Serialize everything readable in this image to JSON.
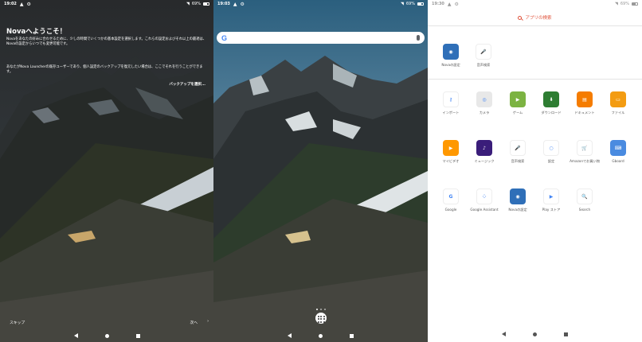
{
  "screen1": {
    "status": {
      "time": "19:02",
      "battery": "69%"
    },
    "title": "Novaへようこそ！",
    "para1": "Novaをあなたの好みに合わせるために、少しの時間でいくつかの基本設定を選択します。これらの設定およびそれ以上の最適は、Novaの設定からいつでも変更可能です。",
    "para2": "あなたがNova Launcherの既存ユーザーであり、個人設定のバックアップを復元したい場合は、ここでそれを行うことができます。",
    "backup_button": "バックアップを選択...",
    "skip_button": "スキップ",
    "next_button": "次へ",
    "next_chevron": "›"
  },
  "screen2": {
    "status": {
      "time": "19:03",
      "battery": "69%"
    },
    "search_logo": "G"
  },
  "screen3": {
    "status": {
      "time": "19:30",
      "battery": "69%"
    },
    "search_label": "アプリの検索",
    "favorites": [
      {
        "label": "Novaの設定",
        "color": "#2f6fb8",
        "glyph": "◉"
      },
      {
        "label": "音声検索",
        "color": "#ffffff",
        "glyph": "🎤"
      }
    ],
    "apps": [
      {
        "label": "インポート",
        "color": "#ffffff",
        "glyph": "⚷"
      },
      {
        "label": "カメラ",
        "color": "#e8e8e8",
        "glyph": "◎"
      },
      {
        "label": "ゲーム",
        "color": "#7cb342",
        "glyph": "▶"
      },
      {
        "label": "ダウンロード",
        "color": "#2e7d32",
        "glyph": "⬇"
      },
      {
        "label": "ドキュメント",
        "color": "#f57c00",
        "glyph": "▤"
      },
      {
        "label": "ファイル",
        "color": "#f39c12",
        "glyph": "▭"
      },
      {
        "label": "マイビデオ",
        "color": "#ff9800",
        "glyph": "▶"
      },
      {
        "label": "ミュージック",
        "color": "#3a1d7a",
        "glyph": "♪"
      },
      {
        "label": "音声検索",
        "color": "#ffffff",
        "glyph": "🎤"
      },
      {
        "label": "設定",
        "color": "#ffffff",
        "glyph": "○"
      },
      {
        "label": "Amazonでお買い物",
        "color": "#ffffff",
        "glyph": "🛒"
      },
      {
        "label": "Gboard",
        "color": "#4a8be0",
        "glyph": "⌨"
      },
      {
        "label": "Google",
        "color": "#ffffff",
        "glyph": "G"
      },
      {
        "label": "Google Assistant",
        "color": "#ffffff",
        "glyph": "⁘"
      },
      {
        "label": "Novaの設定",
        "color": "#2f6fb8",
        "glyph": "◉"
      },
      {
        "label": "Play ストア",
        "color": "#ffffff",
        "glyph": "▶"
      },
      {
        "label": "Search",
        "color": "#ffffff",
        "glyph": "🔍"
      }
    ]
  }
}
